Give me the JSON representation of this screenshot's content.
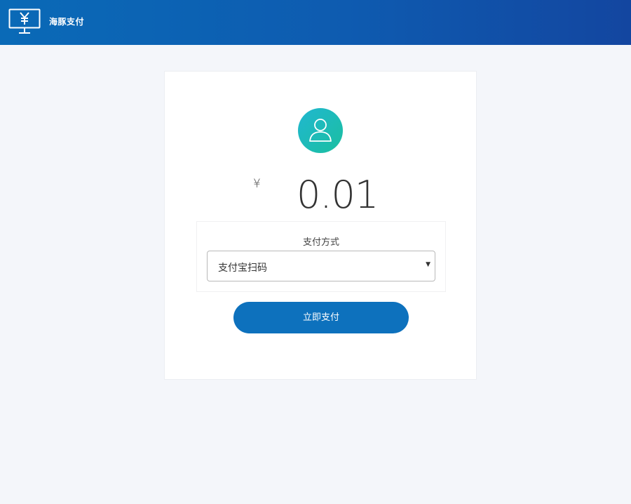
{
  "header": {
    "brand": "海豚支付",
    "logo_icon": "cashier-monitor-icon"
  },
  "order": {
    "avatar_icon": "user-icon",
    "currency_symbol": "¥",
    "amount": "0.01"
  },
  "payment": {
    "label": "支付方式",
    "selected": "支付宝扫码",
    "arrow": "▼"
  },
  "actions": {
    "pay_label": "立即支付"
  },
  "colors": {
    "header_start": "#0a6ab7",
    "header_end": "#1346a0",
    "button": "#0d71bd",
    "avatar": "#1bb8b8"
  }
}
